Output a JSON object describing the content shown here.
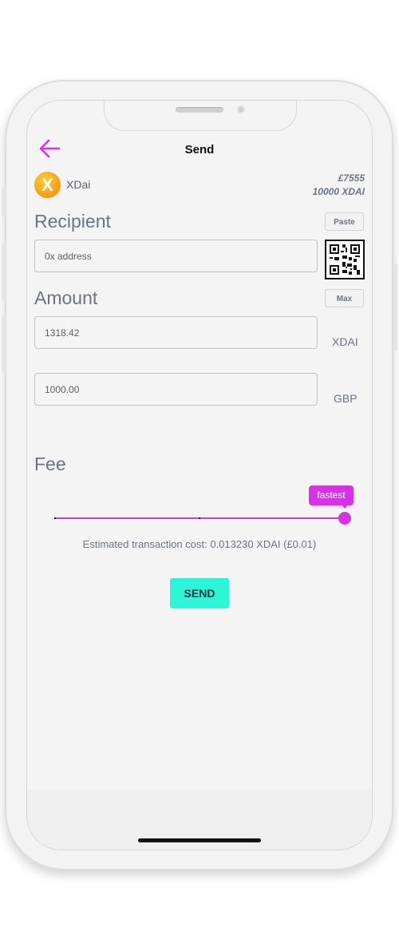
{
  "header": {
    "title": "Send"
  },
  "coin": {
    "name": "XDai",
    "logo_letter": "X",
    "balance_fiat": "£7555",
    "balance_crypto": "10000 XDAI"
  },
  "recipient": {
    "label": "Recipient",
    "paste_label": "Paste",
    "address_placeholder": "0x address",
    "address_value": ""
  },
  "amount": {
    "label": "Amount",
    "max_label": "Max",
    "crypto_value": "1318.42",
    "crypto_unit": "XDAI",
    "fiat_value": "1000.00",
    "fiat_unit": "GBP"
  },
  "fee": {
    "label": "Fee",
    "selected": "fastest",
    "level": 1.0,
    "estimate": "Estimated transaction cost: 0.013230 XDAI (£0.01)"
  },
  "actions": {
    "send_label": "SEND"
  },
  "colors": {
    "accent": "#d633e6",
    "send_button": "#2df5d8",
    "coin": "#f5a10f"
  }
}
